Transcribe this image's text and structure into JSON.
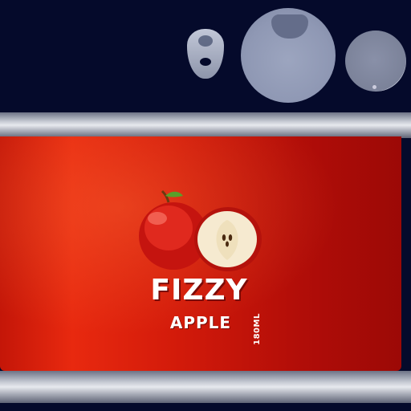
{
  "label": {
    "brand": "FIZZY",
    "flavor": "APPLE",
    "volume": "180ML"
  },
  "colors": {
    "background": "#050a2b",
    "label_red": "#d21a0a",
    "metal": "#c6cad3",
    "text": "#ffffff"
  },
  "icons": {
    "fruit": "apple-icon",
    "fruit_half": "apple-half-icon"
  }
}
